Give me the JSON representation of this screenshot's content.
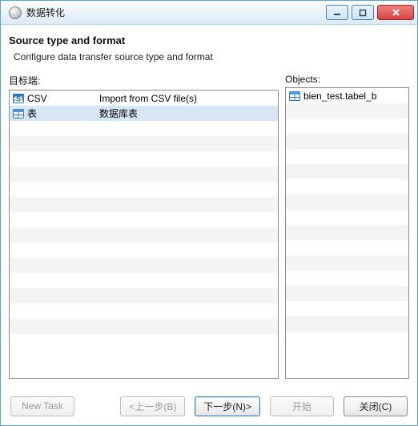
{
  "window": {
    "title": "数据转化"
  },
  "header": {
    "title": "Source type and format",
    "subtitle": "Configure data transfer source type and format"
  },
  "left_panel": {
    "label": "目标端:",
    "rows": [
      {
        "icon": "csv-icon",
        "name": "CSV",
        "desc": "Import from CSV file(s)",
        "selected": false
      },
      {
        "icon": "table-icon",
        "name": "表",
        "desc": "数据库表",
        "selected": true
      }
    ]
  },
  "right_panel": {
    "label": "Objects:",
    "rows": [
      {
        "icon": "table-icon",
        "name": "bien_test.tabel_b"
      }
    ]
  },
  "footer": {
    "new_task": "New Task",
    "back": "<上一步(B)",
    "next": "下一步(N)>",
    "start": "开始",
    "close": "关闭(C)"
  }
}
